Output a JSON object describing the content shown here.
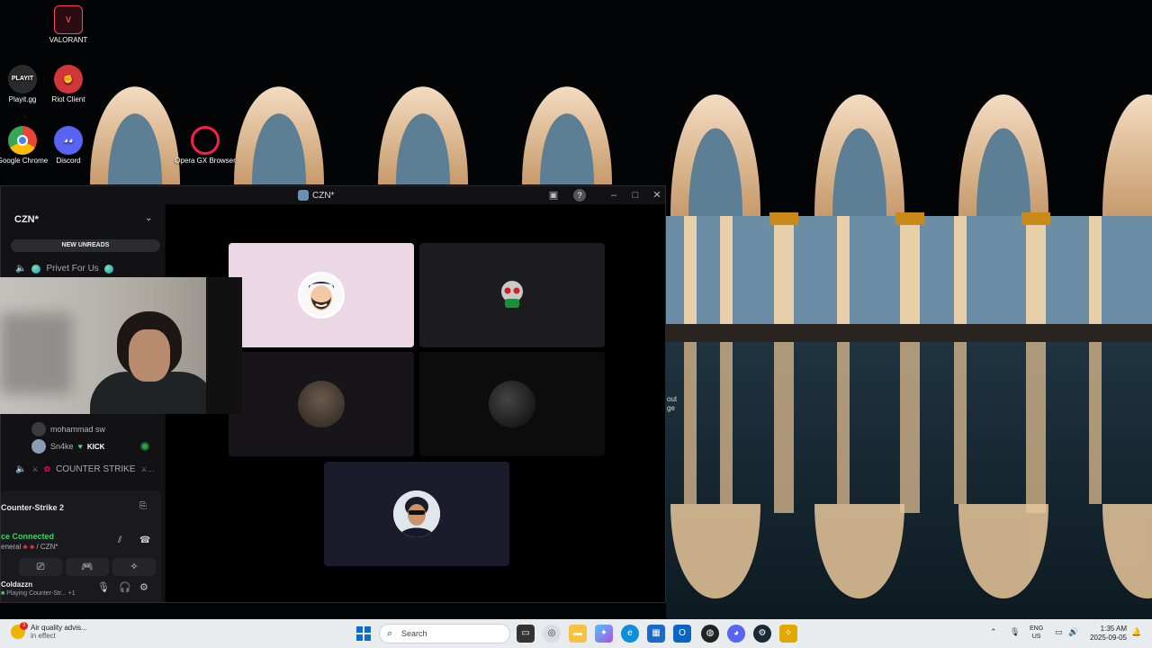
{
  "desktop": {
    "icons": [
      {
        "label": "VALORANT",
        "icon": "valorant-icon",
        "color": "#ff4655"
      },
      {
        "label": "Playit.gg",
        "icon": "playit-icon",
        "color": "#2b2b2b"
      },
      {
        "label": "Riot Client",
        "icon": "riot-client-icon",
        "color": "#d13639"
      },
      {
        "label": "Google Chrome",
        "icon": "chrome-icon",
        "color": "#4285f4"
      },
      {
        "label": "Discord",
        "icon": "discord-icon",
        "color": "#5865f2"
      },
      {
        "label": "Opera GX Browser",
        "icon": "opera-gx-icon",
        "color": "#fa1e4e"
      }
    ],
    "partial_text": [
      "out",
      "ge"
    ]
  },
  "window": {
    "title": "CZN*",
    "server_name": "CZN*",
    "new_unreads": "NEW UNREADS",
    "channels": [
      {
        "name": "Privet For Us"
      },
      {
        "name": "COUNTER STRIKE"
      }
    ],
    "members": [
      {
        "name": "mohammad sw"
      },
      {
        "name": "Sn4ke",
        "badge": "KICK"
      }
    ],
    "activity": "Counter-Strike 2",
    "voice_status": "ce Connected",
    "voice_location": "eneral",
    "voice_server": "/ CZN*",
    "user": {
      "name": "Coldazzn",
      "status": "Playing Counter-Str...",
      "extra": "+1"
    }
  },
  "taskbar": {
    "weather_title": "Air quality advis...",
    "weather_sub": "in effect",
    "weather_badge": "3",
    "search_placeholder": "Search",
    "lang_line1": "ENG",
    "lang_line2": "US",
    "time": "1:35 AM",
    "date": "2025-09-05"
  },
  "colors": {
    "accent_green": "#3fcf6a",
    "discord_bg": "#121214",
    "taskbar_bg": "#e8ecef"
  }
}
